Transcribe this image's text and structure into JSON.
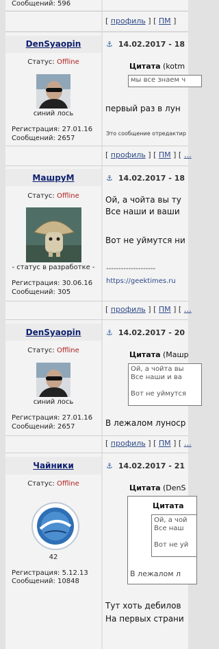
{
  "top_partial": {
    "messages": "Сообщений: 596",
    "links": "[ профиль ] [ ПМ ]"
  },
  "posts": [
    {
      "username": "DenSyaopin",
      "status_label": "Статус:",
      "status_value": "Offline",
      "avatar_caption": "синий лось",
      "registration": "Регистрация: 27.01.16",
      "messages": "Сообщений: 2657",
      "date": "14.02.2017 - 18",
      "quote_label": "Цитата",
      "quote_author": "(kotm",
      "quote_text": "мы все знаем ч",
      "body_line1": "первый раз в лун",
      "edited_note": "Это сообщение отредактир",
      "links": "[ профиль ] [ ПМ ] [ "
    },
    {
      "username": "МашруМ",
      "status_label": "Статус:",
      "status_value": "Offline",
      "avatar_caption": "- статус в разработке -",
      "registration": "Регистрация: 30.06.16",
      "messages": "Сообщений: 305",
      "date": "14.02.2017 - 18",
      "body_line1": "Ой, а чойта вы ту",
      "body_line2": "Все наши и ваши",
      "body_line3": "Вот не уймутся ни",
      "signature_sep": "--------------------",
      "signature_link": "https://geektimes.ru",
      "links": "[ профиль ] [ ПМ ] [ "
    },
    {
      "username": "DenSyaopin",
      "status_label": "Статус:",
      "status_value": "Offline",
      "avatar_caption": "синий лось",
      "registration": "Регистрация: 27.01.16",
      "messages": "Сообщений: 2657",
      "date": "14.02.2017 - 20",
      "quote_label": "Цитата",
      "quote_author": "(Машр",
      "quote_line1": "Ой, а чойта вы",
      "quote_line2": "Все наши и ва",
      "quote_line3": "Вот не уймутся",
      "body_line1": "В лежалом луноср",
      "links": "[ профиль ] [ ПМ ] [ "
    },
    {
      "username": "Чайники",
      "status_label": "Статус:",
      "status_value": "Offline",
      "avatar_caption": "42",
      "registration": "Регистрация: 5.12.13",
      "messages": "Сообщений: 10848",
      "date": "14.02.2017 - 21",
      "quote_label": "Цитата",
      "quote_author": "(DenS",
      "inner_quote_label": "Цитата",
      "inner_line1": "Ой, а чой",
      "inner_line2": "Все наш",
      "inner_line3": "Вот не уй",
      "quote_body": "В лежалом л",
      "body_line1": "Тут хоть дебилов",
      "body_line2": "На первых страни"
    }
  ]
}
